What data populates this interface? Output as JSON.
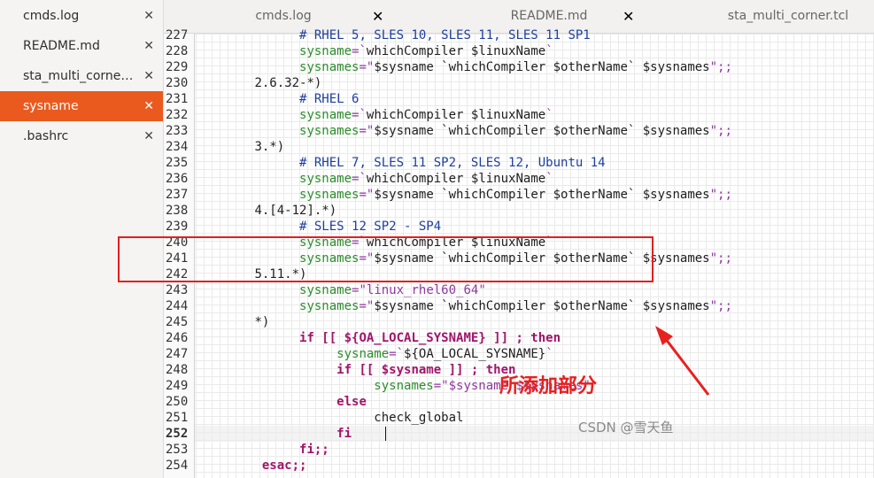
{
  "sidebar": {
    "items": [
      {
        "label": "cmds.log",
        "close": "✕"
      },
      {
        "label": "README.md",
        "close": "✕"
      },
      {
        "label": "sta_multi_corner.tcl",
        "close": "✕"
      },
      {
        "label": "sysname",
        "close": "✕"
      },
      {
        "label": ".bashrc",
        "close": "✕"
      }
    ]
  },
  "tabs": [
    {
      "label": "cmds.log",
      "close": "✕"
    },
    {
      "label": "README.md",
      "close": "✕"
    },
    {
      "label": "sta_multi_corner.tcl"
    }
  ],
  "editor": {
    "current_line": "252",
    "lines": [
      {
        "num": "227",
        "t0": "              ",
        "t1": "# RHEL 5, SLES 10, SLES 11, SLES 11 SP1",
        "t1c": "c"
      },
      {
        "num": "228",
        "t0": "              ",
        "v": "sysname",
        "t2": "=`",
        "t3": "whichCompiler $linuxName",
        "t4": "`"
      },
      {
        "num": "229",
        "t0": "              ",
        "v": "sysnames",
        "t2": "=\"",
        "t3": "$sysname `whichCompiler $otherName` $sysnames",
        "t4": "\";;"
      },
      {
        "num": "230",
        "t0": "        ",
        "t1": "2.6.32-*)",
        "t1c": "n"
      },
      {
        "num": "231",
        "t0": "              ",
        "t1": "# RHEL 6",
        "t1c": "c"
      },
      {
        "num": "232",
        "t0": "              ",
        "v": "sysname",
        "t2": "=`",
        "t3": "whichCompiler $linuxName",
        "t4": "`"
      },
      {
        "num": "233",
        "t0": "              ",
        "v": "sysnames",
        "t2": "=\"",
        "t3": "$sysname `whichCompiler $otherName` $sysnames",
        "t4": "\";;"
      },
      {
        "num": "234",
        "t0": "        ",
        "t1": "3.*)",
        "t1c": "n"
      },
      {
        "num": "235",
        "t0": "              ",
        "t1": "# RHEL 7, SLES 11 SP2, SLES 12, Ubuntu 14",
        "t1c": "c"
      },
      {
        "num": "236",
        "t0": "              ",
        "v": "sysname",
        "t2": "=`",
        "t3": "whichCompiler $linuxName",
        "t4": "`"
      },
      {
        "num": "237",
        "t0": "              ",
        "v": "sysnames",
        "t2": "=\"",
        "t3": "$sysname `whichCompiler $otherName` $sysnames",
        "t4": "\";;"
      },
      {
        "num": "238",
        "t0": "        ",
        "t1": "4.[4-12].*)",
        "t1c": "n"
      },
      {
        "num": "239",
        "t0": "              ",
        "t1": "# SLES 12 SP2 - SP4",
        "t1c": "c"
      },
      {
        "num": "240",
        "t0": "              ",
        "v": "sysname",
        "t2": "=`",
        "t3": "whichCompiler $linuxName",
        "t4": "`"
      },
      {
        "num": "241",
        "t0": "              ",
        "v": "sysnames",
        "t2": "=\"",
        "t3": "$sysname `whichCompiler $otherName` $sysnames",
        "t4": "\";;"
      },
      {
        "num": "242",
        "t0": "        ",
        "t1": "5.11.*)",
        "t1c": "n"
      },
      {
        "num": "243",
        "t0": "              ",
        "v": "sysname",
        "t2": "=\"",
        "t3": "linux_rhel60_64",
        "t4": "\"",
        "t3c": "s"
      },
      {
        "num": "244",
        "t0": "              ",
        "v": "sysnames",
        "t2": "=\"",
        "t3": "$sysname `whichCompiler $otherName` $sysnames",
        "t4": "\";;"
      },
      {
        "num": "245",
        "t0": "        ",
        "t1": "*)",
        "t1c": "n"
      },
      {
        "num": "246",
        "t0": "              ",
        "t1": "if [[ ${OA_LOCAL_SYSNAME} ]] ; then",
        "t1c": "k"
      },
      {
        "num": "247",
        "t0": "                   ",
        "v": "sysname",
        "t2": "=`",
        "t3": "${OA_LOCAL_SYSNAME}",
        "t4": "`"
      },
      {
        "num": "248",
        "t0": "                   ",
        "t1": "if [[ $sysname ]] ; then",
        "t1c": "k"
      },
      {
        "num": "249",
        "t0": "                        ",
        "v": "sysnames",
        "t2": "=\"",
        "t3": "$sysname $sysnames",
        "t4": "\"",
        "t3c": "s"
      },
      {
        "num": "250",
        "t0": "                   ",
        "t1": "else",
        "t1c": "k"
      },
      {
        "num": "251",
        "t0": "                        ",
        "t1": "check_global",
        "t1c": "n"
      },
      {
        "num": "252",
        "t0": "                   ",
        "t1": "fi",
        "t1c": "k"
      },
      {
        "num": "253",
        "t0": "              ",
        "t1": "fi;;",
        "t1c": "k"
      },
      {
        "num": "254",
        "t0": "         ",
        "t1": "esac;;",
        "t1c": "k"
      }
    ]
  },
  "annotation": {
    "label": "所添加部分",
    "color": "#e8201e"
  },
  "watermark": "CSDN @雪天鱼",
  "colors": {
    "accent": "#ea5a1f",
    "highlight_box": "#e0201e"
  }
}
